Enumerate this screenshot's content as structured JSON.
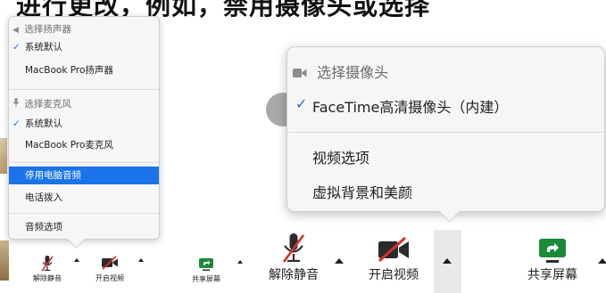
{
  "caption": {
    "text": "进行更改，例如，禁用摄像头或选择"
  },
  "audio_menu": {
    "speaker_header": "选择扬声器",
    "speaker_items": [
      {
        "label": "系统默认",
        "checked": true
      },
      {
        "label": "MacBook Pro扬声器",
        "checked": false
      }
    ],
    "mic_header": "选择麦克风",
    "mic_items": [
      {
        "label": "系统默认",
        "checked": true
      },
      {
        "label": "MacBook Pro麦克风",
        "checked": false
      }
    ],
    "actions": [
      {
        "label": "停用电脑音频",
        "highlighted": true
      },
      {
        "label": "电话拨入",
        "highlighted": false
      }
    ],
    "options_label": "音频选项"
  },
  "camera_menu": {
    "header": "选择摄像头",
    "camera_item": {
      "label": "FaceTime高清摄像头（内建）",
      "checked": true
    },
    "options_label": "视频选项",
    "background_label": "虚拟背景和美颜"
  },
  "toolbar_small": {
    "unmute_label": "解除静音",
    "start_video_label": "开启视频",
    "share_label": "共享屏幕"
  },
  "toolbar_large": {
    "unmute_label": "解除静音",
    "start_video_label": "开启视频",
    "share_label": "共享屏幕"
  },
  "colors": {
    "accent_blue": "#1a73e8",
    "mute_red": "#d93025",
    "share_green": "#1b8a3a",
    "menu_bg": "#f6f6f6"
  }
}
